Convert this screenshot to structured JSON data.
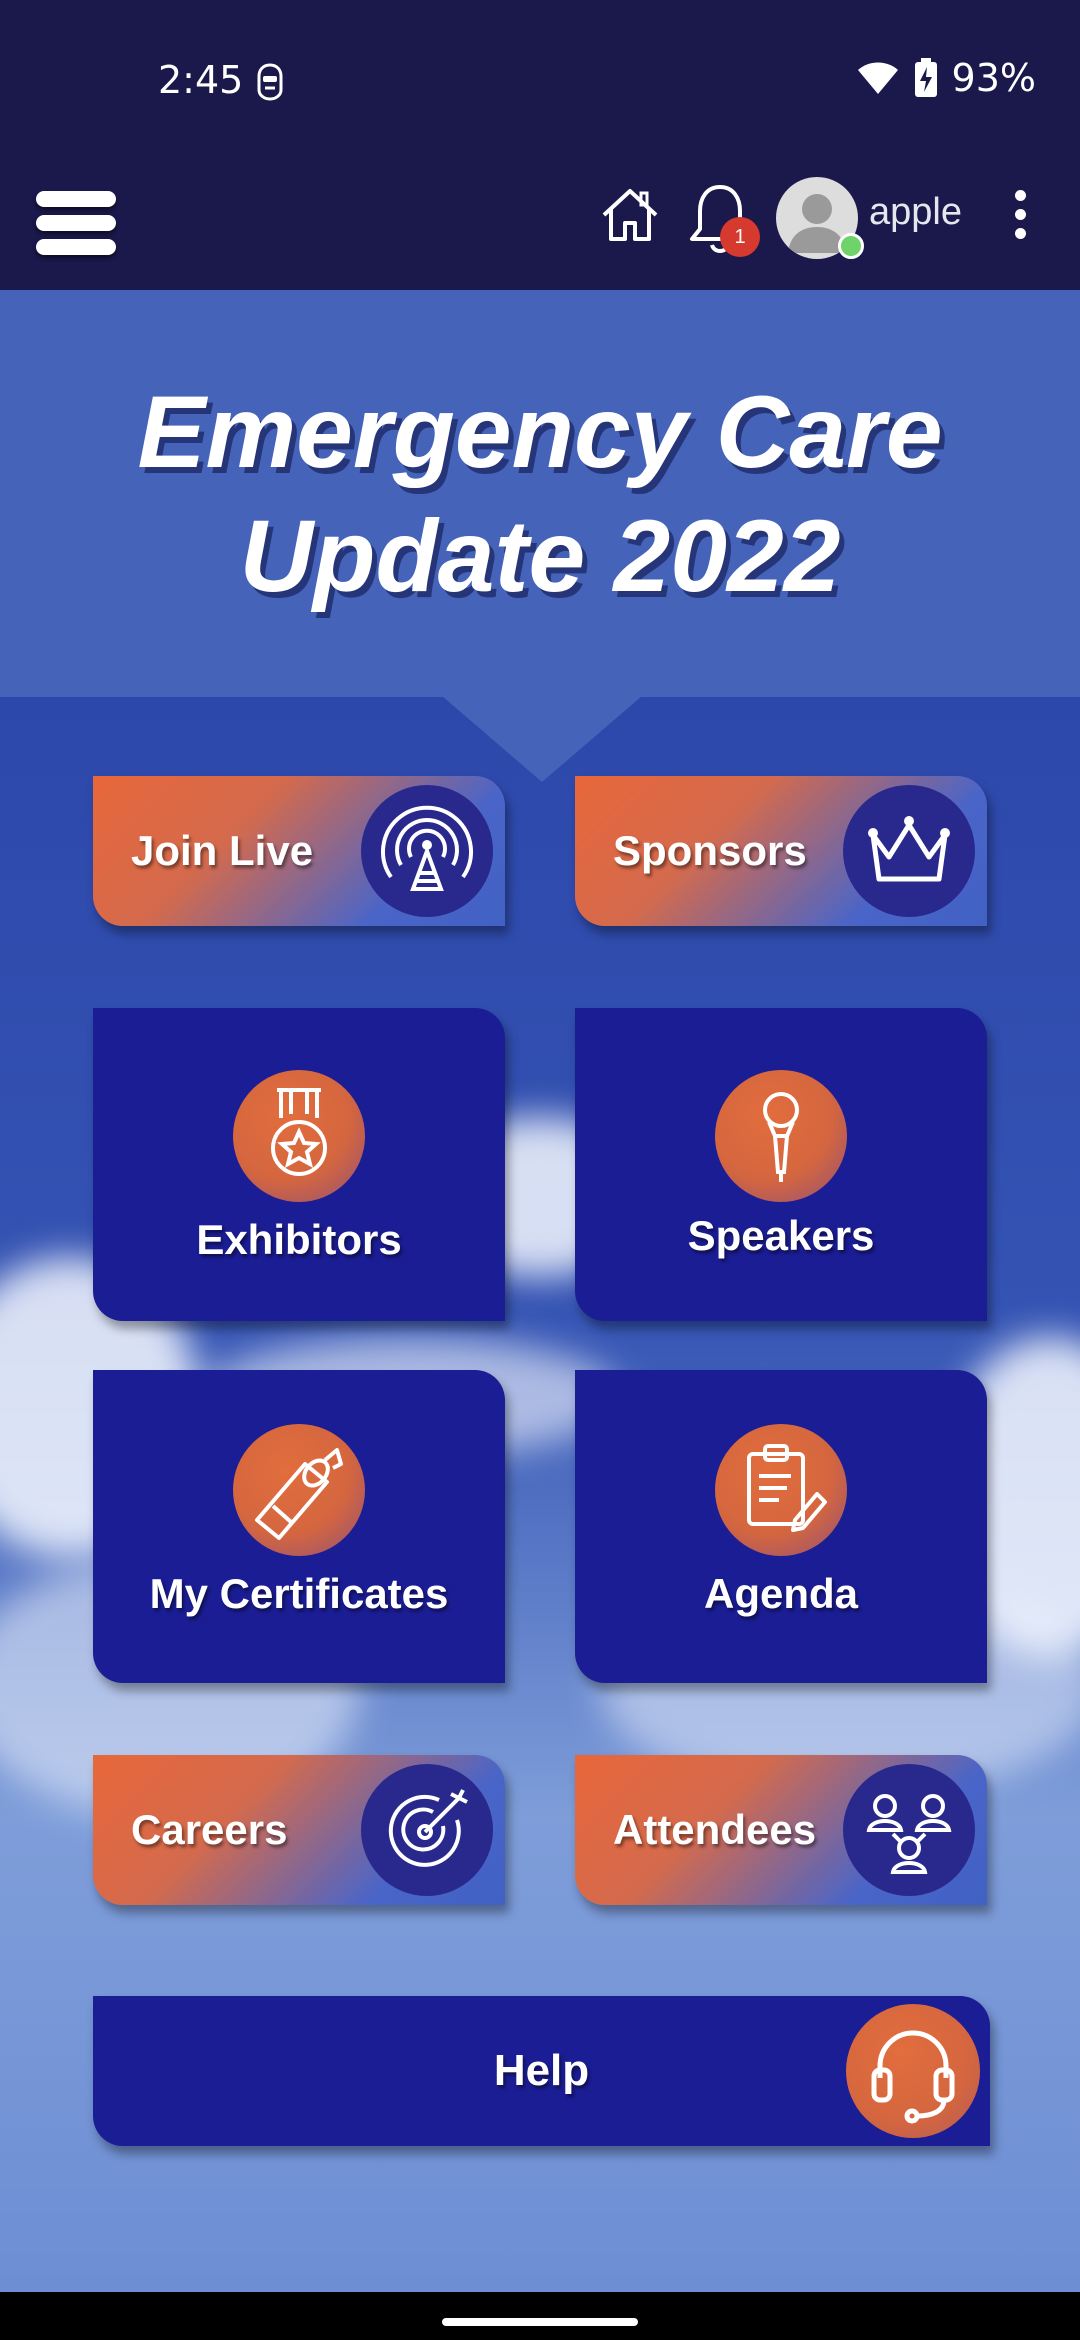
{
  "status_bar": {
    "time": "2:45",
    "battery_percent": "93%",
    "icons": [
      "notification-shield-icon",
      "wifi-icon",
      "battery-charging-icon"
    ]
  },
  "header": {
    "username": "apple",
    "notification_count": "1",
    "icons": [
      "hamburger-menu-icon",
      "home-icon",
      "bell-icon",
      "avatar",
      "more-vert-icon"
    ]
  },
  "title": {
    "line1": "Emergency Care",
    "line2": "Update 2022"
  },
  "tiles": {
    "join_live": {
      "label": "Join Live",
      "icon": "broadcast-tower-icon"
    },
    "sponsors": {
      "label": "Sponsors",
      "icon": "crown-icon"
    },
    "exhibitors": {
      "label": "Exhibitors",
      "icon": "medal-icon"
    },
    "speakers": {
      "label": "Speakers",
      "icon": "microphone-icon"
    },
    "certificates": {
      "label": "My Certificates",
      "icon": "diploma-icon"
    },
    "agenda": {
      "label": "Agenda",
      "icon": "clipboard-icon"
    },
    "careers": {
      "label": "Careers",
      "icon": "target-icon"
    },
    "attendees": {
      "label": "Attendees",
      "icon": "people-icon"
    },
    "help": {
      "label": "Help",
      "icon": "headset-icon"
    }
  },
  "colors": {
    "header_bg": "#1b184b",
    "title_band": "#4463b9",
    "card_bg": "#1b1d94",
    "accent_orange": "#e8673a",
    "online_dot": "#6fd36a",
    "badge_red": "#d63a2e"
  }
}
